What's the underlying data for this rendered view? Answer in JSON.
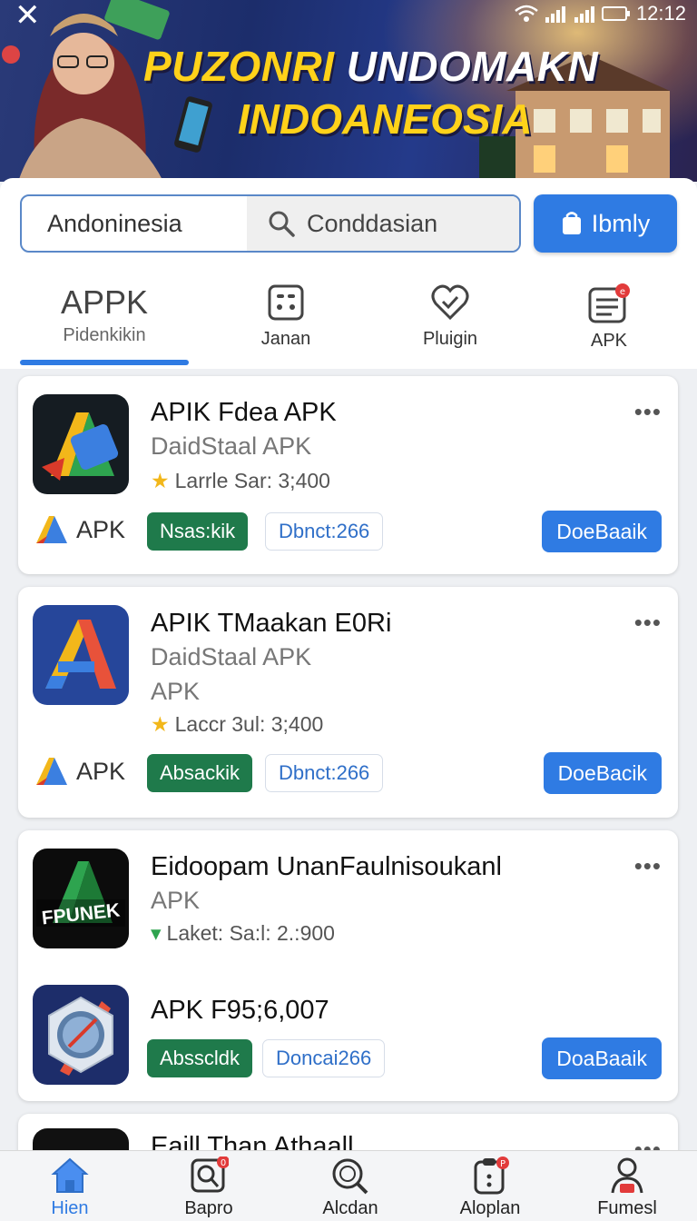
{
  "status": {
    "time": "12:12"
  },
  "banner": {
    "title_a": "PUZONRI",
    "title_b": "UNDOMAKN",
    "title_line2": "INDOANEOSIA"
  },
  "search": {
    "region": "Andoninesia",
    "query": "Conddasian",
    "button_label": "Ibmly"
  },
  "tabs": [
    {
      "title": "APPK",
      "label": "Pidenkikin"
    },
    {
      "label": "Janan"
    },
    {
      "label": "Pluigin"
    },
    {
      "label": "APK"
    }
  ],
  "apps": [
    {
      "title": "APIK Fdea APK",
      "subtitle": "DaidStaal APK",
      "meta": "Larrle Sar: 3;400",
      "brand": "APK",
      "green_chip": "Nsas:kik",
      "outline_chip": "Dbnct:266",
      "action": "DoeBaaik"
    },
    {
      "title": "APIK TMaakan E0Ri",
      "subtitle": "DaidStaal APK",
      "subtitle2": "APK",
      "meta": "Laccr 3ul: 3;400",
      "brand": "APK",
      "green_chip": "Absackik",
      "outline_chip": "Dbnct:266",
      "action": "DoeBacik"
    },
    {
      "title": "Eidoopam UnanFaulnisoukanl",
      "subtitle": "APK",
      "meta": "Laket: Sa:l: 2.:900",
      "icon_text": "FPUNEK",
      "title2": "APK F95;6,007",
      "green_chip": "Absscldk",
      "outline_chip": "Doncai266",
      "action": "DoaBaaik"
    },
    {
      "title": "Eaill Than Athaall"
    }
  ],
  "nav": [
    {
      "label": "Hien",
      "icon": "home-icon"
    },
    {
      "label": "Bapro",
      "icon": "search-doc-icon",
      "badge": "0"
    },
    {
      "label": "Alcdan",
      "icon": "search-icon"
    },
    {
      "label": "Aloplan",
      "icon": "clipboard-icon",
      "badge": "P"
    },
    {
      "label": "Fumesl",
      "icon": "person-icon"
    }
  ],
  "colors": {
    "accent": "#2f7be3",
    "green": "#1f7a4b",
    "banner_text": "#ffd21a"
  }
}
